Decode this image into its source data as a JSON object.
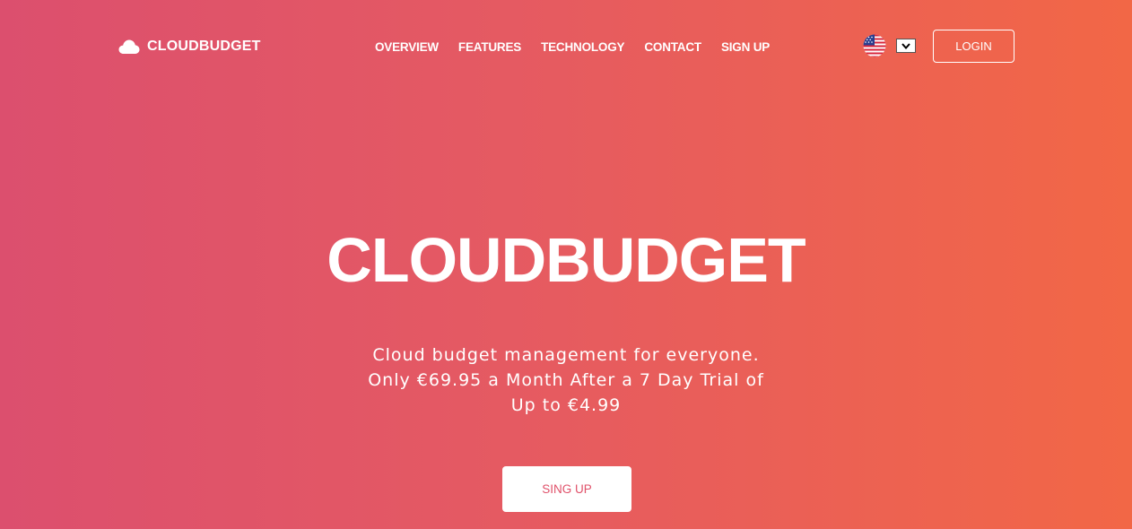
{
  "header": {
    "brand": "CLOUDBUDGET",
    "logo_icon": "cloud-icon",
    "nav": [
      "OVERVIEW",
      "FEATURES",
      "TECHNOLOGY",
      "CONTACT",
      "SIGN UP"
    ],
    "language_flag": "us-flag-icon",
    "language_dropdown_icon": "chevron-down-icon",
    "login_label": "LOGIN"
  },
  "hero": {
    "title": "CLOUDBUDGET",
    "subtitle": "Cloud budget management for everyone. Only €69.95 a Month After a 7 Day Trial of Up to €4.99",
    "cta_label": "SING UP"
  },
  "colors": {
    "gradient_start": "#dc4f6e",
    "gradient_end": "#f26746",
    "cta_text": "#e0516a",
    "text": "#ffffff"
  }
}
